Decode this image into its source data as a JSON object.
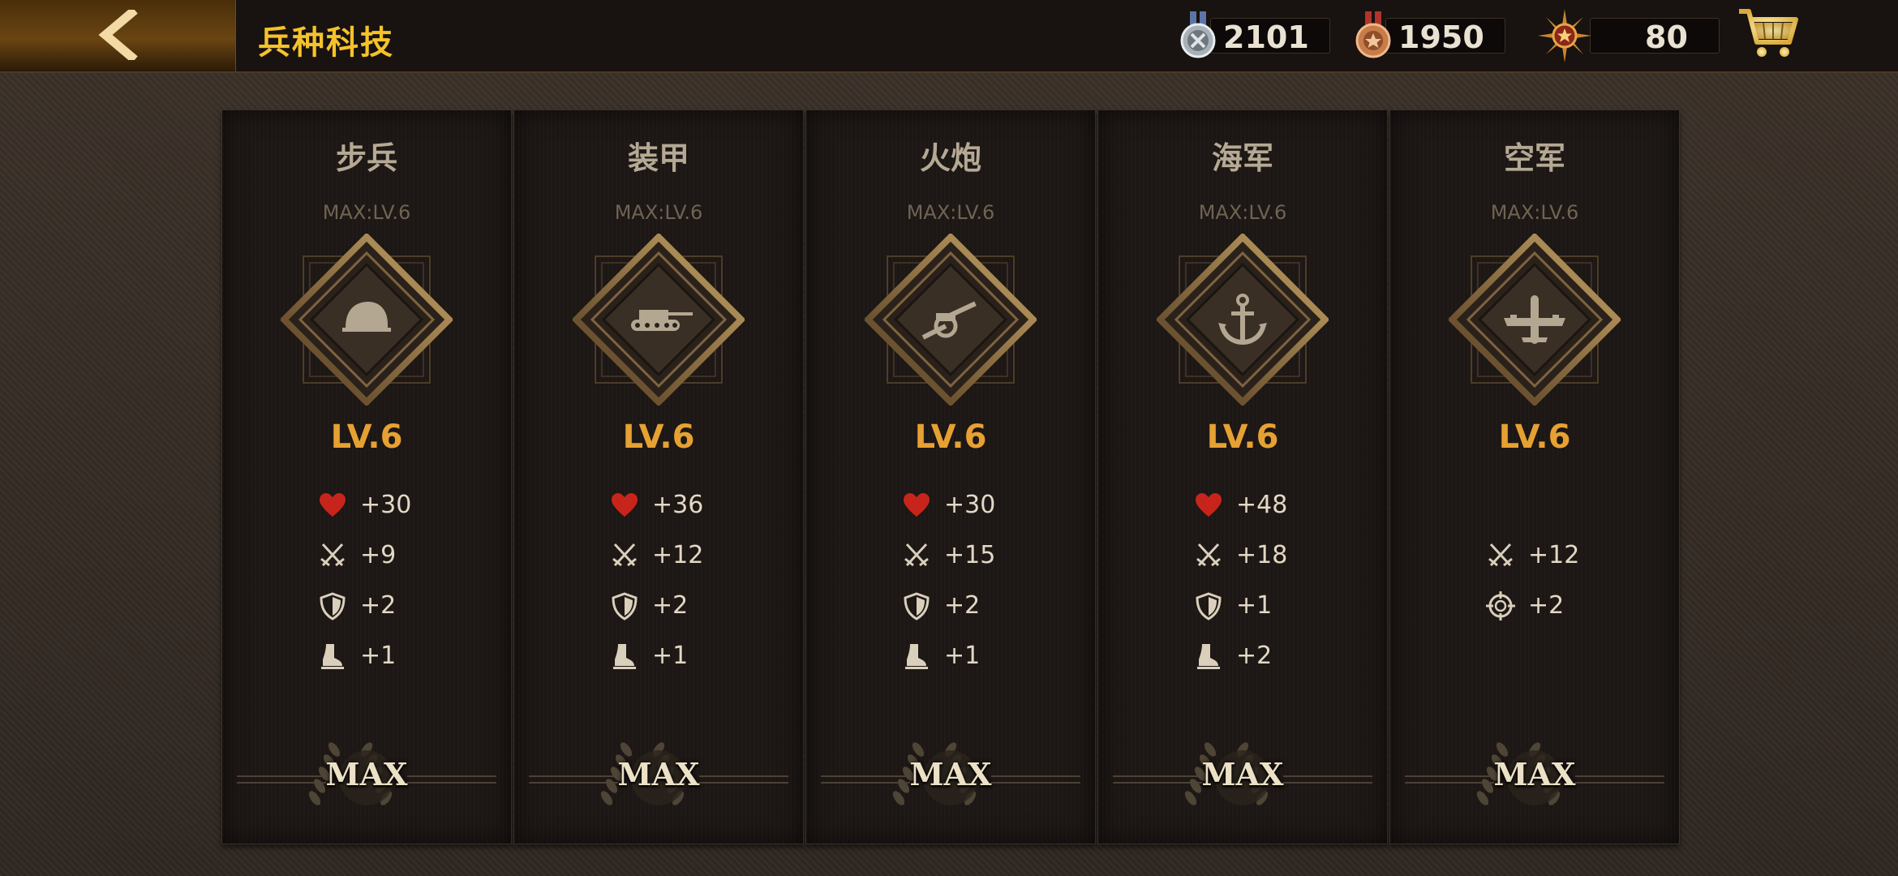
{
  "header": {
    "title": "兵种科技",
    "back_icon": "chevron-left-icon",
    "resources": [
      {
        "icon": "silver-medal-icon",
        "value": "2101"
      },
      {
        "icon": "bronze-medal-icon",
        "value": "1950"
      },
      {
        "icon": "sunburst-star-icon",
        "value": "80"
      }
    ],
    "cart_icon": "shopping-cart-icon"
  },
  "units": [
    {
      "name": "步兵",
      "max_label": "MAX:LV.6",
      "level": "LV.6",
      "icon": "helmet-icon",
      "stats": [
        {
          "icon": "heart-icon",
          "value": "+30"
        },
        {
          "icon": "crossed-swords-icon",
          "value": "+9"
        },
        {
          "icon": "shield-icon",
          "value": "+2"
        },
        {
          "icon": "boot-icon",
          "value": "+1"
        }
      ],
      "badge": "MAX"
    },
    {
      "name": "装甲",
      "max_label": "MAX:LV.6",
      "level": "LV.6",
      "icon": "tank-icon",
      "stats": [
        {
          "icon": "heart-icon",
          "value": "+36"
        },
        {
          "icon": "crossed-swords-icon",
          "value": "+12"
        },
        {
          "icon": "shield-icon",
          "value": "+2"
        },
        {
          "icon": "boot-icon",
          "value": "+1"
        }
      ],
      "badge": "MAX"
    },
    {
      "name": "火炮",
      "max_label": "MAX:LV.6",
      "level": "LV.6",
      "icon": "artillery-icon",
      "stats": [
        {
          "icon": "heart-icon",
          "value": "+30"
        },
        {
          "icon": "crossed-swords-icon",
          "value": "+15"
        },
        {
          "icon": "shield-icon",
          "value": "+2"
        },
        {
          "icon": "boot-icon",
          "value": "+1"
        }
      ],
      "badge": "MAX"
    },
    {
      "name": "海军",
      "max_label": "MAX:LV.6",
      "level": "LV.6",
      "icon": "anchor-icon",
      "stats": [
        {
          "icon": "heart-icon",
          "value": "+48"
        },
        {
          "icon": "crossed-swords-icon",
          "value": "+18"
        },
        {
          "icon": "shield-icon",
          "value": "+1"
        },
        {
          "icon": "boot-icon",
          "value": "+2"
        }
      ],
      "badge": "MAX"
    },
    {
      "name": "空军",
      "max_label": "MAX:LV.6",
      "level": "LV.6",
      "icon": "airplane-icon",
      "stats": [
        {
          "icon": "crossed-swords-icon",
          "value": "+12"
        },
        {
          "icon": "crosshair-icon",
          "value": "+2"
        }
      ],
      "badge": "MAX"
    }
  ],
  "colors": {
    "title": "#f5c22b",
    "level": "#e6a133",
    "heart": "#c7251b"
  }
}
